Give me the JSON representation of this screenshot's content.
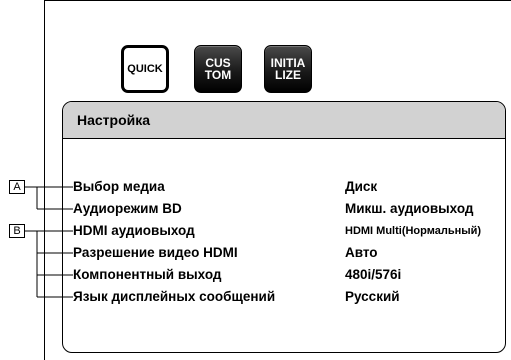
{
  "mode_buttons": [
    {
      "label": "QUICK",
      "state": "selected"
    },
    {
      "label": "CUS\nTOM",
      "state": "unselected"
    },
    {
      "label": "INITIA\nLIZE",
      "state": "unselected"
    }
  ],
  "panel": {
    "title": "Настройка",
    "rows": [
      {
        "label": "Выбор медиа",
        "value": "Диск"
      },
      {
        "label": "Аудиорежим BD",
        "value": "Микш. аудиовыход"
      },
      {
        "label": "HDMI аудиовыход",
        "value": "HDMI Multi(Нормальный)"
      },
      {
        "label": "Разрешение видео HDMI",
        "value": "Авто"
      },
      {
        "label": "Компонентный выход",
        "value": "480i/576i"
      },
      {
        "label": "Язык дисплейных сообщений",
        "value": "Русский"
      }
    ]
  },
  "callouts": {
    "a": "A",
    "b": "B"
  },
  "colors": {
    "header_bg": "#d2d2d2",
    "dark_button": "#1a1a1a"
  }
}
